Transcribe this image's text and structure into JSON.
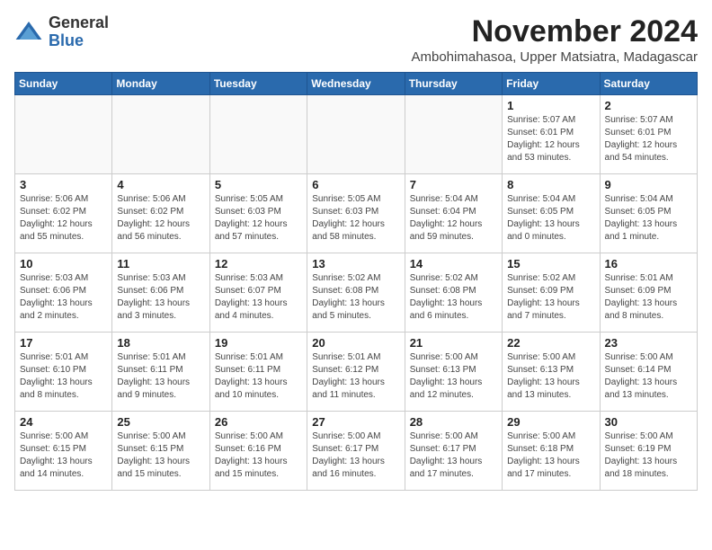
{
  "logo": {
    "general": "General",
    "blue": "Blue"
  },
  "header": {
    "month": "November 2024",
    "location": "Ambohimahasoa, Upper Matsiatra, Madagascar"
  },
  "weekdays": [
    "Sunday",
    "Monday",
    "Tuesday",
    "Wednesday",
    "Thursday",
    "Friday",
    "Saturday"
  ],
  "weeks": [
    [
      {
        "day": "",
        "info": ""
      },
      {
        "day": "",
        "info": ""
      },
      {
        "day": "",
        "info": ""
      },
      {
        "day": "",
        "info": ""
      },
      {
        "day": "",
        "info": ""
      },
      {
        "day": "1",
        "info": "Sunrise: 5:07 AM\nSunset: 6:01 PM\nDaylight: 12 hours\nand 53 minutes."
      },
      {
        "day": "2",
        "info": "Sunrise: 5:07 AM\nSunset: 6:01 PM\nDaylight: 12 hours\nand 54 minutes."
      }
    ],
    [
      {
        "day": "3",
        "info": "Sunrise: 5:06 AM\nSunset: 6:02 PM\nDaylight: 12 hours\nand 55 minutes."
      },
      {
        "day": "4",
        "info": "Sunrise: 5:06 AM\nSunset: 6:02 PM\nDaylight: 12 hours\nand 56 minutes."
      },
      {
        "day": "5",
        "info": "Sunrise: 5:05 AM\nSunset: 6:03 PM\nDaylight: 12 hours\nand 57 minutes."
      },
      {
        "day": "6",
        "info": "Sunrise: 5:05 AM\nSunset: 6:03 PM\nDaylight: 12 hours\nand 58 minutes."
      },
      {
        "day": "7",
        "info": "Sunrise: 5:04 AM\nSunset: 6:04 PM\nDaylight: 12 hours\nand 59 minutes."
      },
      {
        "day": "8",
        "info": "Sunrise: 5:04 AM\nSunset: 6:05 PM\nDaylight: 13 hours\nand 0 minutes."
      },
      {
        "day": "9",
        "info": "Sunrise: 5:04 AM\nSunset: 6:05 PM\nDaylight: 13 hours\nand 1 minute."
      }
    ],
    [
      {
        "day": "10",
        "info": "Sunrise: 5:03 AM\nSunset: 6:06 PM\nDaylight: 13 hours\nand 2 minutes."
      },
      {
        "day": "11",
        "info": "Sunrise: 5:03 AM\nSunset: 6:06 PM\nDaylight: 13 hours\nand 3 minutes."
      },
      {
        "day": "12",
        "info": "Sunrise: 5:03 AM\nSunset: 6:07 PM\nDaylight: 13 hours\nand 4 minutes."
      },
      {
        "day": "13",
        "info": "Sunrise: 5:02 AM\nSunset: 6:08 PM\nDaylight: 13 hours\nand 5 minutes."
      },
      {
        "day": "14",
        "info": "Sunrise: 5:02 AM\nSunset: 6:08 PM\nDaylight: 13 hours\nand 6 minutes."
      },
      {
        "day": "15",
        "info": "Sunrise: 5:02 AM\nSunset: 6:09 PM\nDaylight: 13 hours\nand 7 minutes."
      },
      {
        "day": "16",
        "info": "Sunrise: 5:01 AM\nSunset: 6:09 PM\nDaylight: 13 hours\nand 8 minutes."
      }
    ],
    [
      {
        "day": "17",
        "info": "Sunrise: 5:01 AM\nSunset: 6:10 PM\nDaylight: 13 hours\nand 8 minutes."
      },
      {
        "day": "18",
        "info": "Sunrise: 5:01 AM\nSunset: 6:11 PM\nDaylight: 13 hours\nand 9 minutes."
      },
      {
        "day": "19",
        "info": "Sunrise: 5:01 AM\nSunset: 6:11 PM\nDaylight: 13 hours\nand 10 minutes."
      },
      {
        "day": "20",
        "info": "Sunrise: 5:01 AM\nSunset: 6:12 PM\nDaylight: 13 hours\nand 11 minutes."
      },
      {
        "day": "21",
        "info": "Sunrise: 5:00 AM\nSunset: 6:13 PM\nDaylight: 13 hours\nand 12 minutes."
      },
      {
        "day": "22",
        "info": "Sunrise: 5:00 AM\nSunset: 6:13 PM\nDaylight: 13 hours\nand 13 minutes."
      },
      {
        "day": "23",
        "info": "Sunrise: 5:00 AM\nSunset: 6:14 PM\nDaylight: 13 hours\nand 13 minutes."
      }
    ],
    [
      {
        "day": "24",
        "info": "Sunrise: 5:00 AM\nSunset: 6:15 PM\nDaylight: 13 hours\nand 14 minutes."
      },
      {
        "day": "25",
        "info": "Sunrise: 5:00 AM\nSunset: 6:15 PM\nDaylight: 13 hours\nand 15 minutes."
      },
      {
        "day": "26",
        "info": "Sunrise: 5:00 AM\nSunset: 6:16 PM\nDaylight: 13 hours\nand 15 minutes."
      },
      {
        "day": "27",
        "info": "Sunrise: 5:00 AM\nSunset: 6:17 PM\nDaylight: 13 hours\nand 16 minutes."
      },
      {
        "day": "28",
        "info": "Sunrise: 5:00 AM\nSunset: 6:17 PM\nDaylight: 13 hours\nand 17 minutes."
      },
      {
        "day": "29",
        "info": "Sunrise: 5:00 AM\nSunset: 6:18 PM\nDaylight: 13 hours\nand 17 minutes."
      },
      {
        "day": "30",
        "info": "Sunrise: 5:00 AM\nSunset: 6:19 PM\nDaylight: 13 hours\nand 18 minutes."
      }
    ]
  ]
}
